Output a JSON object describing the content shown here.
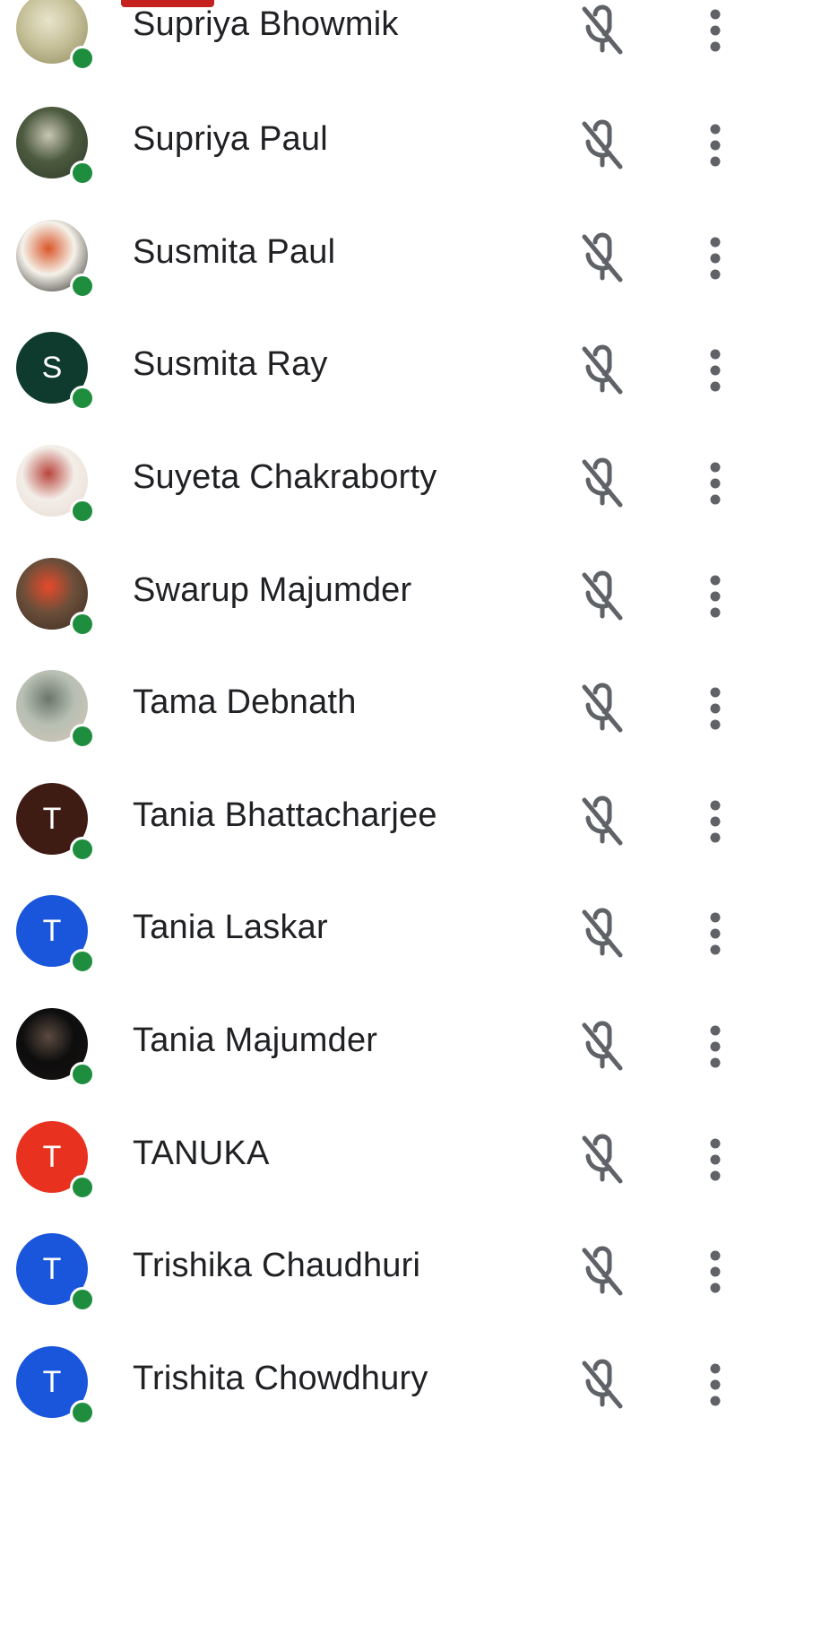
{
  "participants": [
    {
      "name": "Supriya Bhowmik",
      "avatar": {
        "type": "photo",
        "colors": [
          "#c7c19a",
          "#e8e4cc",
          "#8f8a5e"
        ]
      }
    },
    {
      "name": "Supriya Paul",
      "avatar": {
        "type": "photo",
        "colors": [
          "#4c5a3e",
          "#c9c6b3",
          "#2f3a2a"
        ]
      }
    },
    {
      "name": "Susmita Paul",
      "avatar": {
        "type": "photo",
        "colors": [
          "#f5f2ea",
          "#d9572a",
          "#1e1a17"
        ]
      }
    },
    {
      "name": "Susmita Ray",
      "avatar": {
        "type": "letter",
        "letter": "S",
        "color": "#0f3b2e"
      }
    },
    {
      "name": "Suyeta Chakraborty",
      "avatar": {
        "type": "photo",
        "colors": [
          "#f3eee8",
          "#b8453c",
          "#e7d9d0"
        ]
      }
    },
    {
      "name": "Swarup Majumder",
      "avatar": {
        "type": "photo",
        "colors": [
          "#6b4f3a",
          "#e74a2b",
          "#3b2a21"
        ]
      }
    },
    {
      "name": "Tama Debnath",
      "avatar": {
        "type": "photo",
        "colors": [
          "#b7bfb3",
          "#6b766a",
          "#d5c7b8"
        ]
      }
    },
    {
      "name": "Tania Bhattacharjee",
      "avatar": {
        "type": "letter",
        "letter": "T",
        "color": "#3e1c14"
      }
    },
    {
      "name": "Tania Laskar",
      "avatar": {
        "type": "letter",
        "letter": "T",
        "color": "#1a56db"
      }
    },
    {
      "name": "Tania Majumder",
      "avatar": {
        "type": "photo",
        "colors": [
          "#0d0d0d",
          "#5a4a40",
          "#1a1412"
        ]
      }
    },
    {
      "name": "TANUKA",
      "avatar": {
        "type": "letter",
        "letter": "T",
        "color": "#e8321f"
      }
    },
    {
      "name": "Trishika Chaudhuri",
      "avatar": {
        "type": "letter",
        "letter": "T",
        "color": "#1a56db"
      }
    },
    {
      "name": "Trishita Chowdhury",
      "avatar": {
        "type": "letter",
        "letter": "T",
        "color": "#1a56db"
      }
    }
  ],
  "icons": {
    "mic": "mic-off-icon",
    "more": "more-vert-icon"
  },
  "colors": {
    "presence": "#1e8e3e",
    "text": "#202124",
    "icon": "#5f6368",
    "tab_indicator": "#c5221f"
  }
}
